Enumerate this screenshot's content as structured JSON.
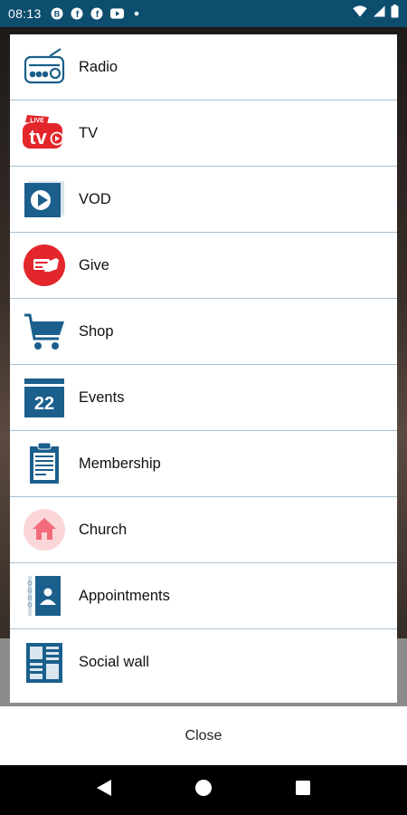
{
  "status_bar": {
    "time": "08:13",
    "notification_icons": [
      "notification-b-icon",
      "facebook-icon",
      "facebook-icon",
      "youtube-icon",
      "dot-icon"
    ],
    "right_icons": [
      "wifi-icon",
      "signal-icon",
      "battery-icon"
    ]
  },
  "menu": {
    "items": [
      {
        "label": "Radio",
        "icon": "radio-icon"
      },
      {
        "label": "TV",
        "icon": "live-tv-icon",
        "icon_text_live": "LIVE",
        "icon_text_tv": "tv"
      },
      {
        "label": "VOD",
        "icon": "vod-icon"
      },
      {
        "label": "Give",
        "icon": "give-icon"
      },
      {
        "label": "Shop",
        "icon": "cart-icon"
      },
      {
        "label": "Events",
        "icon": "calendar-icon",
        "icon_text": "22"
      },
      {
        "label": "Membership",
        "icon": "clipboard-icon"
      },
      {
        "label": "Church",
        "icon": "church-icon"
      },
      {
        "label": "Appointments",
        "icon": "contact-book-icon"
      },
      {
        "label": "Social wall",
        "icon": "social-wall-icon"
      }
    ]
  },
  "close": {
    "label": "Close"
  },
  "nav": {
    "icons": [
      "back-icon",
      "home-icon",
      "recents-icon"
    ]
  },
  "colors": {
    "status_bar": "#0d4d6e",
    "icon_blue": "#1b5f8c",
    "icon_red": "#e3262b",
    "divider": "#a9bfd0"
  }
}
